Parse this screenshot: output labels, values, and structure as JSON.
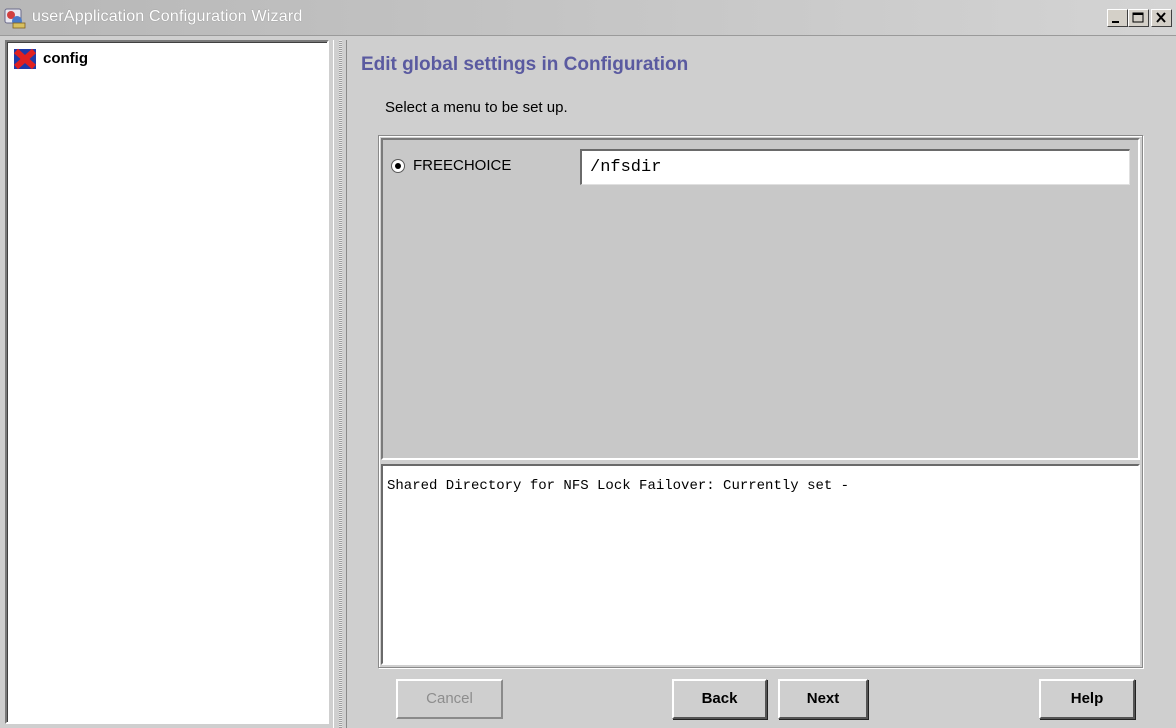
{
  "window": {
    "title": "userApplication Configuration Wizard",
    "controls": [
      "minimize-icon",
      "maximize-icon",
      "close-icon"
    ]
  },
  "tree": {
    "items": [
      {
        "label": "config",
        "icon": "config-node-icon"
      }
    ]
  },
  "main": {
    "heading": "Edit global settings in Configuration",
    "heading_color": "#5a5aa0",
    "instruction": "Select a menu to be set up.",
    "options": [
      {
        "label": "FREECHOICE",
        "selected": true,
        "value": "/nfsdir"
      }
    ],
    "description": "Shared Directory for NFS Lock Failover: Currently set -"
  },
  "buttons": {
    "cancel": {
      "label": "Cancel",
      "enabled": false
    },
    "back": {
      "label": "Back",
      "enabled": true
    },
    "next": {
      "label": "Next",
      "enabled": true
    },
    "help": {
      "label": "Help",
      "enabled": true
    }
  }
}
